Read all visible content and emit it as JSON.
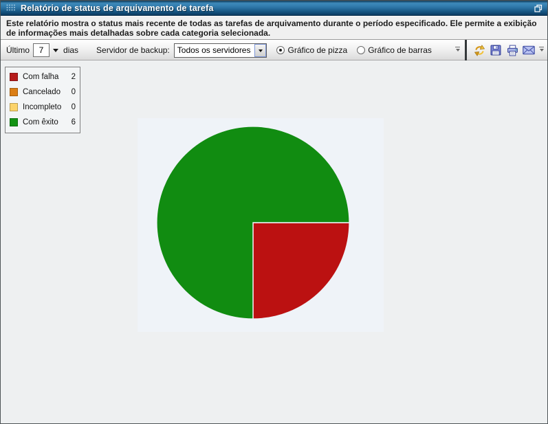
{
  "window": {
    "title": "Relatório de status de arquivamento de tarefa"
  },
  "description": {
    "text": "Este relatório mostra o status mais recente de todas as tarefas de arquivamento durante o período especificado. Ele permite a exibição de informações mais detalhadas sobre cada categoria selecionada."
  },
  "toolbar": {
    "period_label": "Último",
    "period_value": "7",
    "period_unit": "dias",
    "server_label": "Servidor de backup:",
    "server_value": "Todos os servidores",
    "chart_type_options": [
      {
        "label": "Gráfico de pizza",
        "selected": true
      },
      {
        "label": "Gráfico de barras",
        "selected": false
      }
    ],
    "action_icons": [
      "refresh-icon",
      "save-icon",
      "print-icon",
      "email-icon"
    ]
  },
  "chart_data": {
    "type": "pie",
    "total": 8,
    "start_angle_deg_from_east": 0,
    "direction": "clockwise",
    "legend_position": "top-left",
    "slices": [
      {
        "label": "Com falha",
        "value": 2,
        "color": "#bb1111",
        "legend_color": "#b61c1c"
      },
      {
        "label": "Cancelado",
        "value": 0,
        "color": "#db7e15",
        "legend_color": "#db7e15"
      },
      {
        "label": "Incompleto",
        "value": 0,
        "color": "#fbd36a",
        "legend_color": "#fbd36a"
      },
      {
        "label": "Com êxito",
        "value": 6,
        "color": "#118c11",
        "legend_color": "#139313"
      }
    ]
  },
  "colors": {
    "titlebar_blue": "#2e77a8",
    "panel_background": "#eff3f8",
    "content_background": "#eef0f1"
  }
}
